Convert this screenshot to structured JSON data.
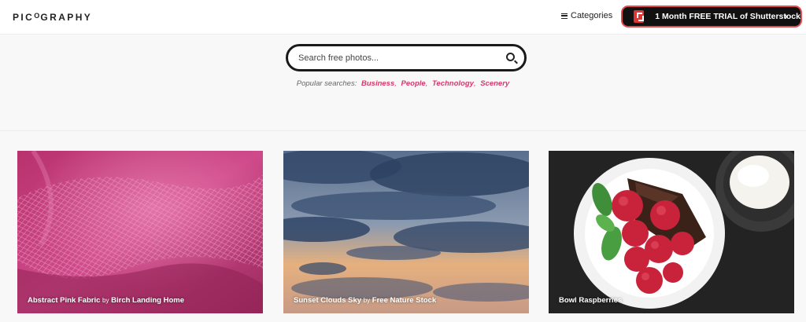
{
  "header": {
    "logo_pre": "PIC",
    "logo_o": "O",
    "logo_post": "GRAPHY",
    "categories_label": "Categories",
    "trial_label": "1 Month FREE TRIAL of Shutterstock",
    "chevron": "›"
  },
  "search": {
    "placeholder": "Search free photos..."
  },
  "popular": {
    "label": "Popular searches:",
    "items": [
      "Business",
      "People",
      "Technology",
      "Scenery"
    ]
  },
  "cards": [
    {
      "title": "Abstract Pink Fabric",
      "by": "by",
      "author": "Birch Landing Home"
    },
    {
      "title": "Sunset Clouds Sky",
      "by": "by",
      "author": "Free Nature Stock"
    },
    {
      "title": "Bowl Raspberries",
      "by": "",
      "author": ""
    }
  ],
  "colors": {
    "accent": "#d6386a",
    "trial_border": "#e34b4b",
    "trial_bg": "#111111"
  }
}
